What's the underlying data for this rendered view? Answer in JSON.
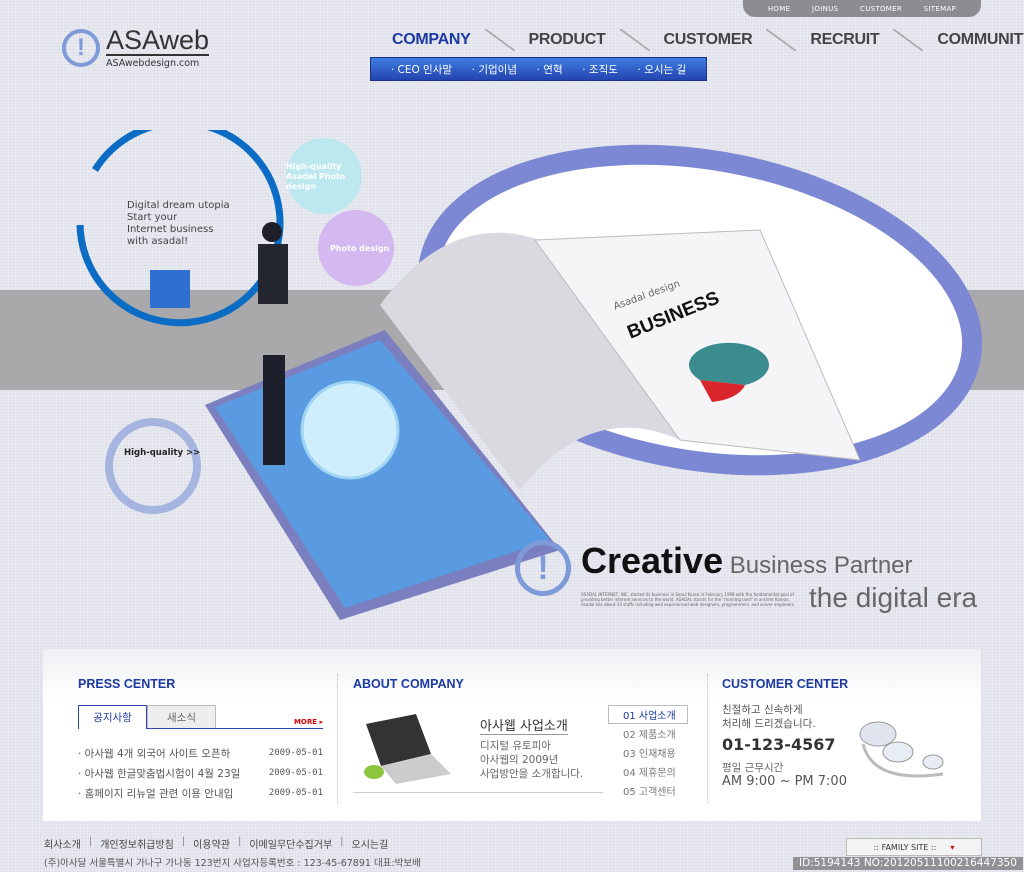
{
  "util_nav": [
    "HOME",
    "JOINUS",
    "CUSTOMER",
    "SITEMAP"
  ],
  "logo": {
    "name": "ASAweb",
    "domain": "ASAwebdesign.com",
    "mark": "!"
  },
  "gnb": [
    {
      "label": "COMPANY",
      "active": true
    },
    {
      "label": "PRODUCT"
    },
    {
      "label": "CUSTOMER"
    },
    {
      "label": "RECRUIT"
    },
    {
      "label": "COMMUNITY"
    }
  ],
  "subnav": [
    "· CEO 인사말",
    "· 기업이념",
    "· 연혁",
    "· 조직도",
    "· 오시는 길"
  ],
  "hero": {
    "intro": [
      "Digital dream utopia",
      "Start your",
      "Internet business",
      "with asadal!"
    ],
    "bubble1": "High-quality Asadal Photo design",
    "bubble2": "Photo design",
    "bubble3": "High-quality >>",
    "book_title": "BUSINESS",
    "book_brand": "Asadal design",
    "headline_bold": "Creative",
    "headline_rest": "Business Partner",
    "headline_line2": "the digital era",
    "blurb": "ASADAL INTERNET, INC. started its business in Seoul Korea in February 1998 with the fundamental goal of providing better internet services to the world. ASADAL stands for the \"morning land\" in ancient Korean. Asadal has about 33 staffs including well experienced web designers, programmers, and server engineers."
  },
  "press": {
    "title": "PRESS CENTER",
    "tabs": [
      "공지사항",
      "새소식"
    ],
    "more": "MORE ▸",
    "items": [
      {
        "title": "· 아사웹 4개 외국어 사이트 오픈하",
        "date": "2009-05-01"
      },
      {
        "title": "· 아사웹 한글맞춤법시험이 4월 23일",
        "date": "2009-05-01"
      },
      {
        "title": "· 홈페이지 리뉴얼 관련 이용 안내입",
        "date": "2009-05-01"
      }
    ]
  },
  "about": {
    "title": "ABOUT COMPANY",
    "heading": "아사웹 사업소개",
    "desc": [
      "디지털 유토피아",
      "아사웹의 2009년",
      "사업방안을 소개합니다."
    ],
    "menu": [
      "01 사업소개",
      "02 제품소개",
      "03 인재채용",
      "04 제휴문의",
      "05 고객센터"
    ]
  },
  "customer": {
    "title": "CUSTOMER CENTER",
    "desc": [
      "친절하고 신속하게",
      "처리해 드리겠습니다."
    ],
    "phone": "01-123-4567",
    "hours_label": "평일 근무시간",
    "hours": "AM 9:00 ~ PM 7:00"
  },
  "footer": {
    "links": [
      "회사소개",
      "개인정보취급방침",
      "이용약관",
      "이메일무단수집거부",
      "오시는길"
    ],
    "address": "(주)아사달 서울특별시 가나구 가나동 123번지    사업자등록번호 : 123-45-67891    대표:박보배",
    "family_site": ":: FAMILY SITE ::"
  },
  "watermark": "ID:5194143 NO:20120511100216447350",
  "colors": {
    "accent": "#1c3aa4",
    "ring": "#7f9ad8",
    "blue_ring": "#0a6cc4"
  }
}
